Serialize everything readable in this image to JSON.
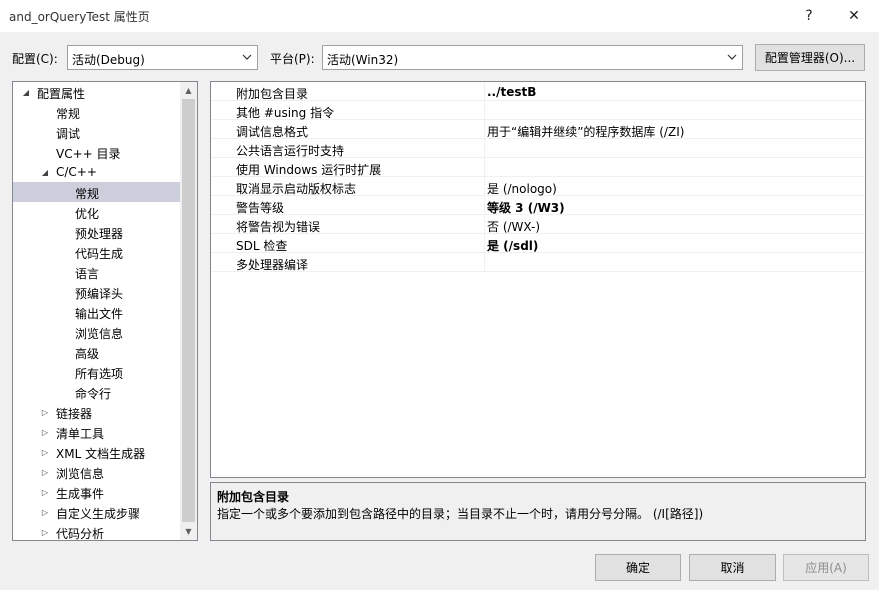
{
  "window": {
    "title": "and_orQueryTest 属性页",
    "help_label": "?",
    "close_label": "✕"
  },
  "toolbar": {
    "config_label": "配置(C):",
    "config_value": "活动(Debug)",
    "platform_label": "平台(P):",
    "platform_value": "活动(Win32)",
    "config_manager_label": "配置管理器(O)..."
  },
  "tree": {
    "items": [
      {
        "label": "配置属性",
        "expander": "◢"
      },
      {
        "label": "常规",
        "expander": ""
      },
      {
        "label": "调试",
        "expander": ""
      },
      {
        "label": "VC++ 目录",
        "expander": ""
      },
      {
        "label": "C/C++",
        "expander": "◢"
      },
      {
        "label": "常规",
        "expander": ""
      },
      {
        "label": "优化",
        "expander": ""
      },
      {
        "label": "预处理器",
        "expander": ""
      },
      {
        "label": "代码生成",
        "expander": ""
      },
      {
        "label": "语言",
        "expander": ""
      },
      {
        "label": "预编译头",
        "expander": ""
      },
      {
        "label": "输出文件",
        "expander": ""
      },
      {
        "label": "浏览信息",
        "expander": ""
      },
      {
        "label": "高级",
        "expander": ""
      },
      {
        "label": "所有选项",
        "expander": ""
      },
      {
        "label": "命令行",
        "expander": ""
      },
      {
        "label": "链接器",
        "expander": "▷"
      },
      {
        "label": "清单工具",
        "expander": "▷"
      },
      {
        "label": "XML 文档生成器",
        "expander": "▷"
      },
      {
        "label": "浏览信息",
        "expander": "▷"
      },
      {
        "label": "生成事件",
        "expander": "▷"
      },
      {
        "label": "自定义生成步骤",
        "expander": "▷"
      },
      {
        "label": "代码分析",
        "expander": "▷"
      }
    ],
    "scroll_up": "▲",
    "scroll_down": "▼"
  },
  "properties": [
    {
      "name": "附加包含目录",
      "value": "../testB"
    },
    {
      "name": "其他 #using 指令",
      "value": ""
    },
    {
      "name": "调试信息格式",
      "value": "用于“编辑并继续”的程序数据库 (/ZI)"
    },
    {
      "name": "公共语言运行时支持",
      "value": ""
    },
    {
      "name": "使用 Windows 运行时扩展",
      "value": ""
    },
    {
      "name": "取消显示启动版权标志",
      "value": "是 (/nologo)"
    },
    {
      "name": "警告等级",
      "value": "等级 3 (/W3)"
    },
    {
      "name": "将警告视为错误",
      "value": "否 (/WX-)"
    },
    {
      "name": "SDL 检查",
      "value": "是 (/sdl)"
    },
    {
      "name": "多处理器编译",
      "value": ""
    }
  ],
  "description": {
    "title": "附加包含目录",
    "text": "指定一个或多个要添加到包含路径中的目录；当目录不止一个时，请用分号分隔。     (/I[路径])"
  },
  "buttons": {
    "ok": "确定",
    "cancel": "取消",
    "apply": "应用(A)"
  }
}
